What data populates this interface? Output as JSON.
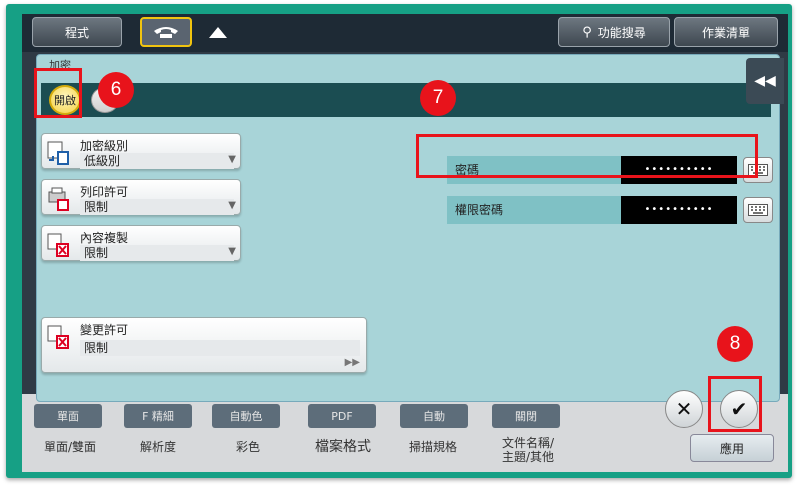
{
  "topbar": {
    "program_label": "程式",
    "search_label": "功能搜尋",
    "jobs_label": "作業清單"
  },
  "bottom": {
    "tabs": [
      "單面",
      "F 精細",
      "自動色",
      "PDF",
      "自動",
      "關閉"
    ],
    "labels": [
      "單面/雙面",
      "解析度",
      "彩色",
      "檔案格式",
      "掃描規格",
      "文件名稱/\n主題/其他"
    ],
    "apply_label": "應用"
  },
  "dialog": {
    "title": "加密",
    "open_label": "開啟",
    "settings": [
      {
        "title": "加密級別",
        "value": "低級別"
      },
      {
        "title": "列印許可",
        "value": "限制"
      },
      {
        "title": "內容複製",
        "value": "限制"
      },
      {
        "title": "變更許可",
        "value": "限制"
      }
    ],
    "password_label": "密碼",
    "password_value": "••••••••••",
    "perm_password_label": "權限密碼",
    "perm_password_value": "••••••••••"
  },
  "badges": {
    "b6": "6",
    "b7": "7",
    "b8": "8"
  },
  "colors": {
    "frame": "#16a085",
    "highlight": "#e8131b",
    "dialog_bg": "#a8d4d8",
    "header": "#1b4d52"
  }
}
